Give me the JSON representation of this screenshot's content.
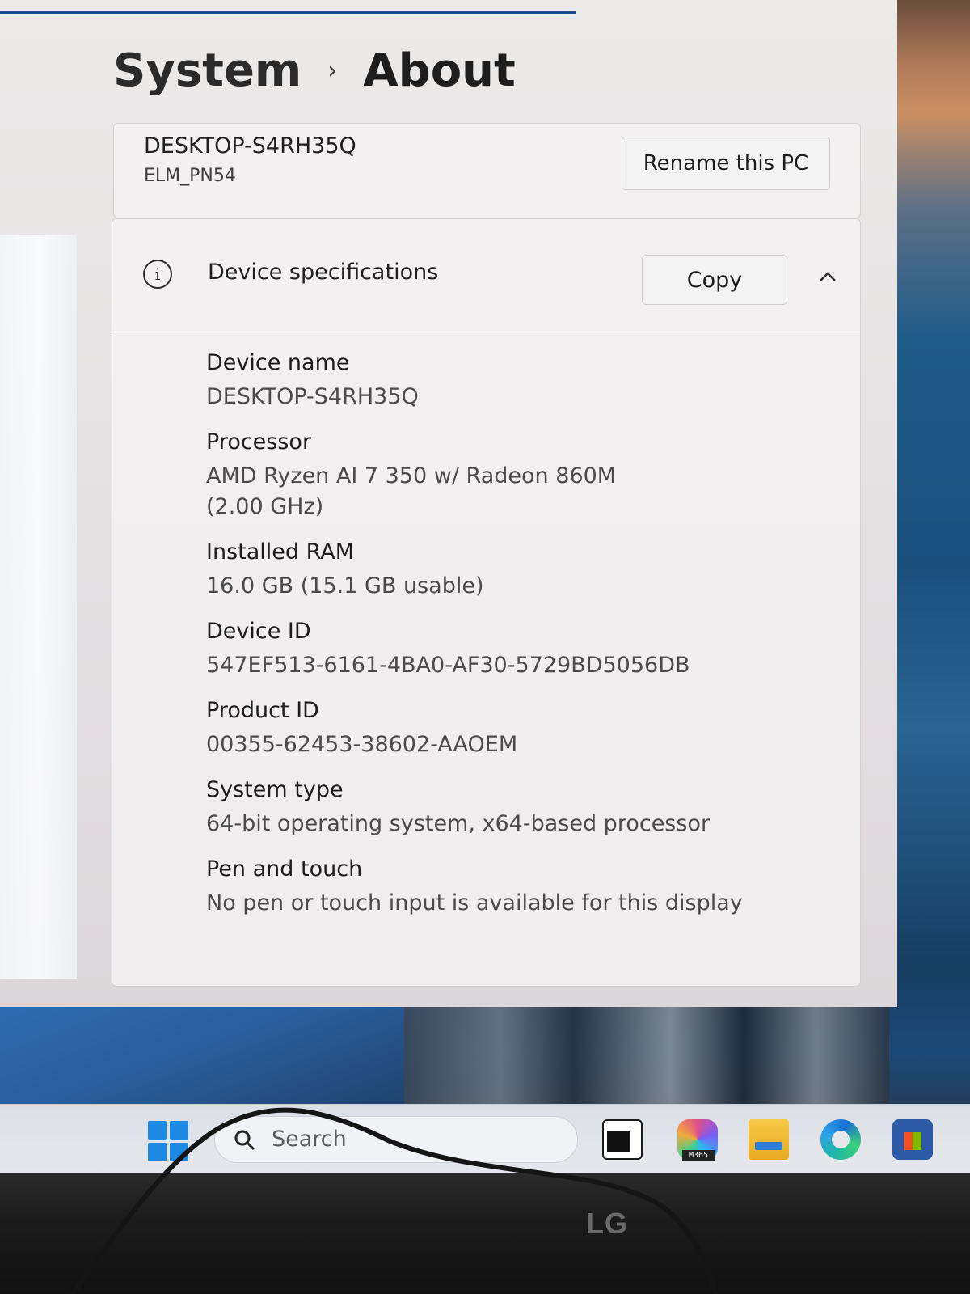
{
  "breadcrumb": {
    "parent": "System",
    "separator": "›",
    "current": "About"
  },
  "pc_card": {
    "name": "DESKTOP-S4RH35Q",
    "model": "ELM_PN54",
    "rename_button": "Rename this PC"
  },
  "device_specs": {
    "title": "Device specifications",
    "copy_button": "Copy",
    "expanded": true,
    "items": [
      {
        "label": "Device name",
        "value": "DESKTOP-S4RH35Q"
      },
      {
        "label": "Processor",
        "value": "AMD Ryzen AI 7 350 w/ Radeon 860M                 (2.00 GHz)"
      },
      {
        "label": "Installed RAM",
        "value": "16.0 GB (15.1 GB usable)"
      },
      {
        "label": "Device ID",
        "value": "547EF513-6161-4BA0-AF30-5729BD5056DB"
      },
      {
        "label": "Product ID",
        "value": "00355-62453-38602-AAOEM"
      },
      {
        "label": "System type",
        "value": "64-bit operating system, x64-based processor"
      },
      {
        "label": "Pen and touch",
        "value": "No pen or touch input is available for this display"
      }
    ]
  },
  "taskbar": {
    "search_text": "Search",
    "m365_badge": "M365",
    "icons": [
      "windows-start-icon",
      "search-icon",
      "task-view-icon",
      "m365-copilot-icon",
      "file-explorer-icon",
      "edge-icon",
      "store-icon"
    ]
  },
  "monitor": {
    "brand": "LG"
  },
  "colors": {
    "accent": "#1d4c8a",
    "start_blue": "#1e88e5"
  }
}
